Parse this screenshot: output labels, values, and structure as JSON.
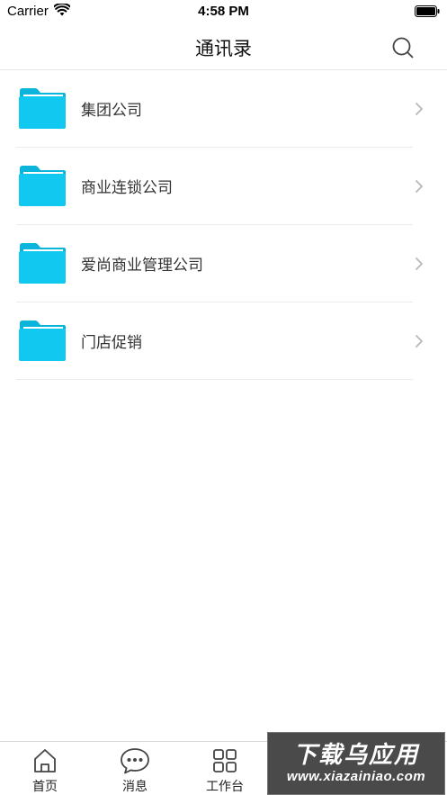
{
  "status_bar": {
    "carrier": "Carrier",
    "time": "4:58 PM"
  },
  "header": {
    "title": "通讯录",
    "search_icon": "search-icon"
  },
  "contacts": {
    "items": [
      {
        "label": "集团公司",
        "icon": "folder-icon"
      },
      {
        "label": "商业连锁公司",
        "icon": "folder-icon"
      },
      {
        "label": "爱尚商业管理公司",
        "icon": "folder-icon"
      },
      {
        "label": "门店促销",
        "icon": "folder-icon"
      }
    ]
  },
  "tab_bar": {
    "tabs": [
      {
        "label": "首页",
        "icon": "home-icon"
      },
      {
        "label": "消息",
        "icon": "chat-bubble-icon"
      },
      {
        "label": "工作台",
        "icon": "grid-icon"
      }
    ]
  },
  "watermark": {
    "title": "下载乌应用",
    "url": "www.xiazainiao.com"
  },
  "colors": {
    "folder": "#10C8F0",
    "folder_tab": "#0BB4DA",
    "separator": "#ECECEC",
    "chevron": "#B8B8B8"
  }
}
